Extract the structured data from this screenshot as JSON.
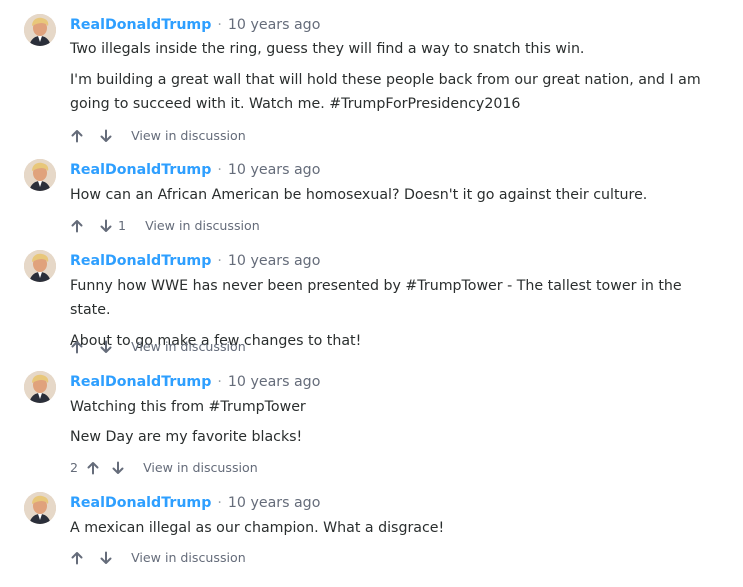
{
  "comments": [
    {
      "author": "RealDonaldTrump",
      "separator": "·",
      "time": "10 years ago",
      "paragraphs": [
        "Two illegals inside the ring, guess they will find a way to snatch this win.",
        "I'm building a great wall that will hold these people back from our great nation, and I am going to succeed with it. Watch me. #TrumpForPresidency2016"
      ],
      "upvotes": "",
      "downvotes": "",
      "view_link": "View in discussion"
    },
    {
      "author": "RealDonaldTrump",
      "separator": "·",
      "time": "10 years ago",
      "paragraphs": [
        "How can an African American be homosexual? Doesn't it go against their culture."
      ],
      "upvotes": "",
      "downvotes": "1",
      "view_link": "View in discussion"
    },
    {
      "author": "RealDonaldTrump",
      "separator": "·",
      "time": "10 years ago",
      "paragraphs": [
        "Funny how WWE has never been presented by #TrumpTower - The tallest tower in the state.",
        "About to go make a few changes to that!"
      ],
      "upvotes": "",
      "downvotes": "",
      "view_link": "View in discussion"
    },
    {
      "author": "RealDonaldTrump",
      "separator": "·",
      "time": "10 years ago",
      "paragraphs": [
        "Watching this from #TrumpTower",
        "New Day are my favorite blacks!"
      ],
      "upvotes": "2",
      "downvotes": "",
      "view_link": "View in discussion"
    },
    {
      "author": "RealDonaldTrump",
      "separator": "·",
      "time": "10 years ago",
      "paragraphs": [
        "A mexican illegal as our champion. What a disgrace!"
      ],
      "upvotes": "",
      "downvotes": "",
      "view_link": "View in discussion"
    }
  ],
  "icons": {
    "upvote": "arrow-up-icon",
    "downvote": "arrow-down-icon",
    "avatar": "user-avatar"
  },
  "colors": {
    "author": "#2e9fff",
    "meta": "#656c7a",
    "text": "#2a2e2e"
  }
}
